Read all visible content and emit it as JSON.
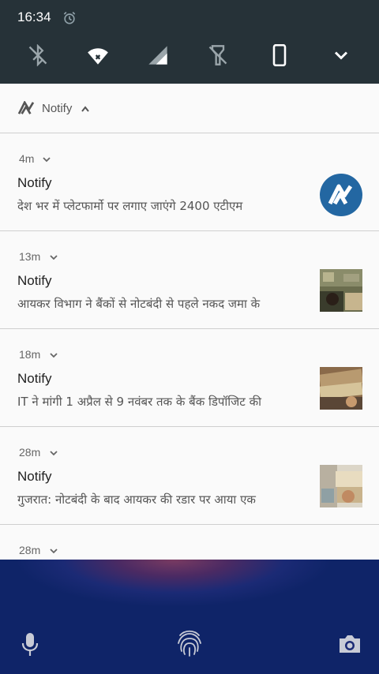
{
  "status_bar": {
    "time": "16:34",
    "alarm_icon": "alarm-clock-icon"
  },
  "quick_settings": {
    "tiles": [
      {
        "name": "bluetooth-off-icon"
      },
      {
        "name": "wifi-icon"
      },
      {
        "name": "cellular-signal-icon"
      },
      {
        "name": "flashlight-off-icon"
      },
      {
        "name": "rotation-portrait-icon"
      },
      {
        "name": "expand-chevron-icon"
      }
    ]
  },
  "notification_group": {
    "app_name": "Notify",
    "logo_icon": "notify-logo-icon",
    "collapse_icon": "chevron-up-icon"
  },
  "notifications": [
    {
      "time": "4m",
      "title": "Notify",
      "text": "देश भर में प्लेटफार्मो पर लगाए जाएंगे 2400 एटीएम",
      "thumb": "notify-logo"
    },
    {
      "time": "13m",
      "title": "Notify",
      "text": "आयकर विभाग ने बैंकों से नोटबंदी से पहले नकद जमा के",
      "thumb": "photo"
    },
    {
      "time": "18m",
      "title": "Notify",
      "text": "IT ने मांगी 1 अप्रैल से 9 नवंबर तक के बैंक डिपॉजिट की",
      "thumb": "photo"
    },
    {
      "time": "28m",
      "title": "Notify",
      "text": "गुजरात: नोटबंदी के बाद आयकर की रडार पर आया एक",
      "thumb": "photo"
    },
    {
      "time": "28m"
    }
  ],
  "lock_screen": {
    "left_icon": "microphone-icon",
    "center_icon": "fingerprint-icon",
    "right_icon": "camera-icon"
  },
  "colors": {
    "header_bg": "#263238",
    "shade_bg": "#fafafa",
    "accent_logo": "#2367a2"
  }
}
